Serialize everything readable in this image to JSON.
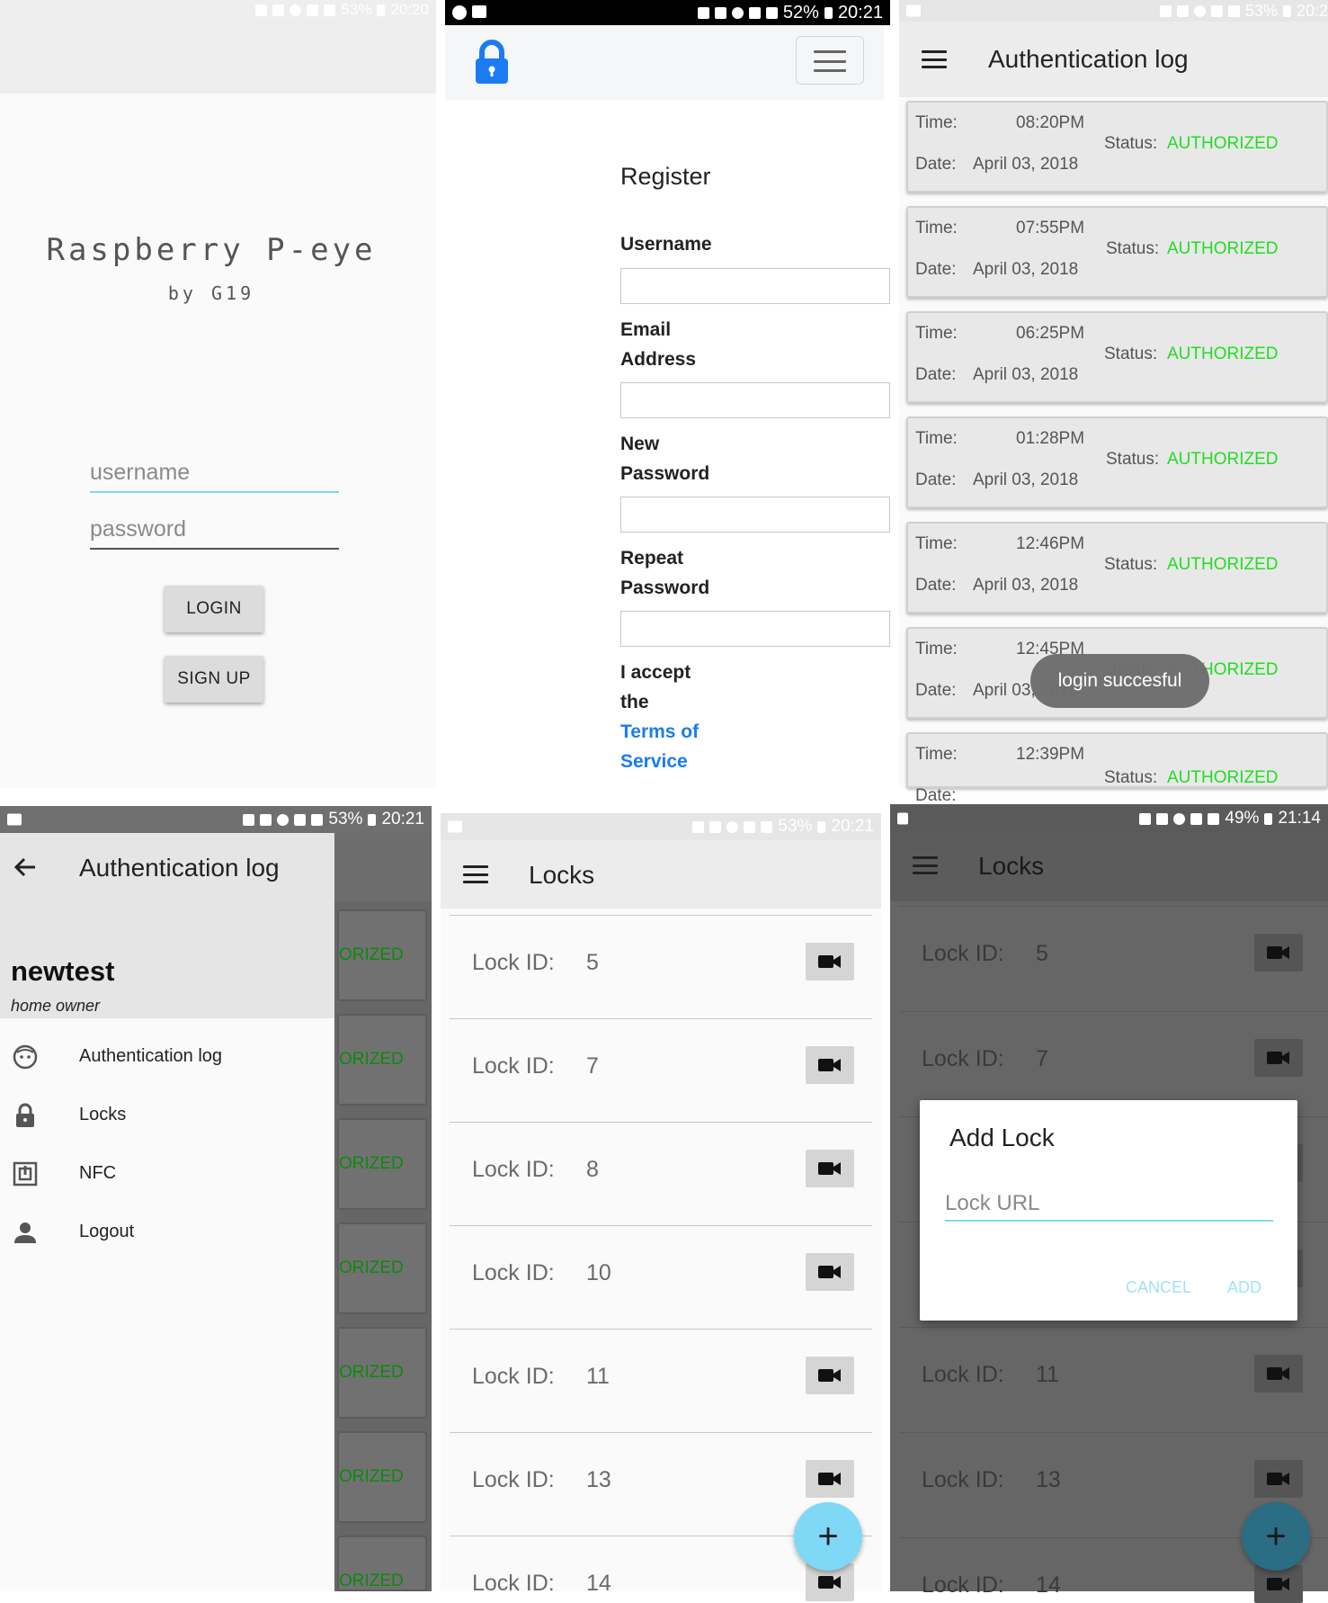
{
  "status_bars": {
    "p1": {
      "battery": "53%",
      "time": "20:20"
    },
    "p2": {
      "battery": "52%",
      "time": "20:21"
    },
    "p3": {
      "battery": "53%",
      "time": "20:2"
    },
    "p4": {
      "battery": "53%",
      "time": "20:21"
    },
    "p5": {
      "battery": "53%",
      "time": "20:21"
    },
    "p6": {
      "battery": "49%",
      "time": "21:14"
    }
  },
  "login": {
    "title": "Raspberry P-eye",
    "subtitle": "by G19",
    "username_placeholder": "username",
    "password_placeholder": "password",
    "login_label": "LOGIN",
    "signup_label": "SIGN UP"
  },
  "register": {
    "heading": "Register",
    "username_label": "Username",
    "email_label_1": "Email",
    "email_label_2": "Address",
    "new_password_1": "New",
    "new_password_2": "Password",
    "repeat_password_1": "Repeat",
    "repeat_password_2": "Password",
    "accept_1": "I accept",
    "accept_2": "the",
    "terms_1": "Terms of",
    "terms_2": "Service",
    "icon": "lock-icon",
    "accent_color": "#1a7cf0"
  },
  "auth_log": {
    "title": "Authentication log",
    "time_label": "Time:",
    "date_label": "Date:",
    "status_label": "Status:",
    "status_color": "#22dd22",
    "entries": [
      {
        "time": "08:20PM",
        "date": "April 03, 2018",
        "status": "AUTHORIZED"
      },
      {
        "time": "07:55PM",
        "date": "April 03, 2018",
        "status": "AUTHORIZED"
      },
      {
        "time": "06:25PM",
        "date": "April 03, 2018",
        "status": "AUTHORIZED"
      },
      {
        "time": "01:28PM",
        "date": "April 03, 2018",
        "status": "AUTHORIZED"
      },
      {
        "time": "12:46PM",
        "date": "April 03, 2018",
        "status": "AUTHORIZED"
      },
      {
        "time": "12:45PM",
        "date": "April 03, 2018",
        "status": "AUTHORIZED"
      },
      {
        "time": "12:39PM",
        "date": "",
        "status": "AUTHORIZED"
      }
    ],
    "toast": "login succesful"
  },
  "drawer": {
    "header_title": "Authentication log",
    "user_name": "newtest",
    "user_role": "home owner",
    "items": [
      {
        "label": "Authentication log",
        "icon": "face-icon"
      },
      {
        "label": "Locks",
        "icon": "lock-icon"
      },
      {
        "label": "NFC",
        "icon": "nfc-icon"
      },
      {
        "label": "Logout",
        "icon": "person-icon"
      }
    ],
    "behind_status": "ORIZED"
  },
  "locks": {
    "title": "Locks",
    "lock_label": "Lock ID:",
    "ids": [
      "5",
      "7",
      "8",
      "10",
      "11",
      "13",
      "14"
    ],
    "fab_label": "+",
    "fab_color": "#7fd8f5"
  },
  "add_lock": {
    "title": "Locks",
    "lock_label": "Lock ID:",
    "visible_ids": [
      "5",
      "7",
      "11",
      "13",
      "14"
    ],
    "dialog_title": "Add Lock",
    "input_placeholder": "Lock URL",
    "cancel_label": "CANCEL",
    "add_label": "ADD",
    "fab_label": "+",
    "fab_color": "#2b6d83",
    "dialog_accent": "#80d8f0"
  }
}
